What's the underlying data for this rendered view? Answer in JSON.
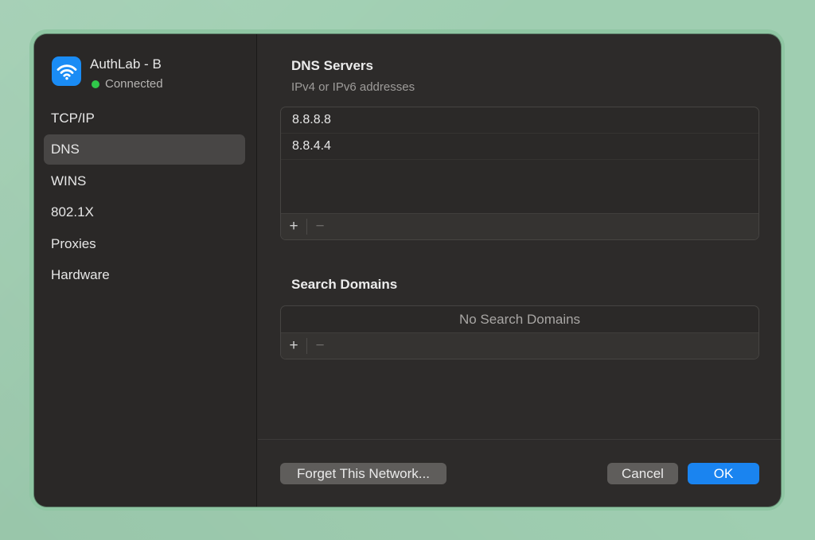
{
  "network": {
    "name": "AuthLab - B",
    "status": "Connected",
    "status_color": "#30c84a",
    "icon": "wifi-icon",
    "icon_bg": "#1a8cf5"
  },
  "sidebar": {
    "selected": "DNS",
    "items": [
      {
        "label": "TCP/IP"
      },
      {
        "label": "DNS"
      },
      {
        "label": "WINS"
      },
      {
        "label": "802.1X"
      },
      {
        "label": "Proxies"
      },
      {
        "label": "Hardware"
      }
    ]
  },
  "dns": {
    "title": "DNS Servers",
    "subtitle": "IPv4 or IPv6 addresses",
    "servers": [
      "8.8.8.8",
      "8.8.4.4"
    ],
    "add_label": "+",
    "remove_label": "−"
  },
  "search_domains": {
    "title": "Search Domains",
    "empty_text": "No Search Domains",
    "add_label": "+",
    "remove_label": "−"
  },
  "footer": {
    "forget_label": "Forget This Network...",
    "cancel_label": "Cancel",
    "ok_label": "OK"
  },
  "colors": {
    "accent": "#1a84f0",
    "window_bg": "#2d2b2a",
    "desktop_bg": "#9fceb1"
  }
}
